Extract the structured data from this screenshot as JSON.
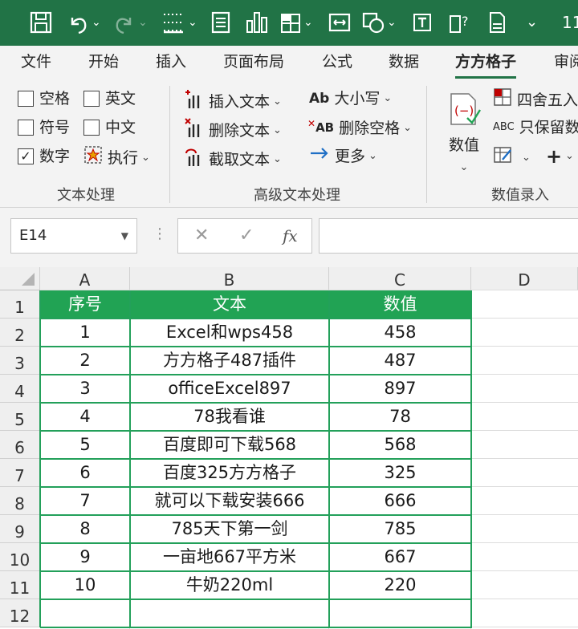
{
  "qat": {
    "icons": [
      "save-icon",
      "undo-icon",
      "redo-icon",
      "borders-icon",
      "form-icon",
      "chart-icon",
      "table-icon",
      "fit-icon",
      "shapes-icon",
      "textbox-icon",
      "help-icon",
      "doc-icon",
      "customize-icon"
    ],
    "number_fragment": "11"
  },
  "tabs": [
    "文件",
    "开始",
    "插入",
    "页面布局",
    "公式",
    "数据",
    "方方格子",
    "审阅"
  ],
  "active_tab": "方方格子",
  "ribbon": {
    "text_processing": {
      "items": [
        {
          "label": "空格",
          "checked": false
        },
        {
          "label": "英文",
          "checked": false
        },
        {
          "label": "符号",
          "checked": false
        },
        {
          "label": "中文",
          "checked": false
        },
        {
          "label": "数字",
          "checked": true
        }
      ],
      "execute_label": "执行",
      "group_label": "文本处理"
    },
    "advanced_text": {
      "insert_text": "插入文本",
      "delete_text": "删除文本",
      "extract_text": "截取文本",
      "case_label": "大小写",
      "case_icon_text": "Ab",
      "remove_spaces": "删除空格",
      "remove_spaces_icon_text": "AB",
      "more": "更多",
      "group_label": "高级文本处理"
    },
    "numeric_entry": {
      "value_label": "数值",
      "round_label": "四舍五入",
      "keep_label": "只保留数",
      "keep_icon_text": "ABC",
      "group_label": "数值录入"
    }
  },
  "formula_bar": {
    "name_box": "E14",
    "cancel_glyph": "✕",
    "enter_glyph": "✓",
    "fx_glyph": "fx",
    "value": ""
  },
  "sheet": {
    "columns": [
      "A",
      "B",
      "C",
      "D"
    ],
    "row_numbers": [
      "1",
      "2",
      "3",
      "4",
      "5",
      "6",
      "7",
      "8",
      "9",
      "10",
      "11",
      "12"
    ],
    "header": [
      "序号",
      "文本",
      "数值"
    ],
    "rows": [
      [
        "1",
        "Excel和wps458",
        "458"
      ],
      [
        "2",
        "方方格子487插件",
        "487"
      ],
      [
        "3",
        "officeExcel897",
        "897"
      ],
      [
        "4",
        "78我看谁",
        "78"
      ],
      [
        "5",
        "百度即可下载568",
        "568"
      ],
      [
        "6",
        "百度325方方格子",
        "325"
      ],
      [
        "7",
        "就可以下载安装666",
        "666"
      ],
      [
        "8",
        "785天下第一剑",
        "785"
      ],
      [
        "9",
        "一亩地667平方米",
        "667"
      ],
      [
        "10",
        "牛奶220ml",
        "220"
      ]
    ],
    "header_fill": "#21a354",
    "border_color": "#23a05a"
  }
}
